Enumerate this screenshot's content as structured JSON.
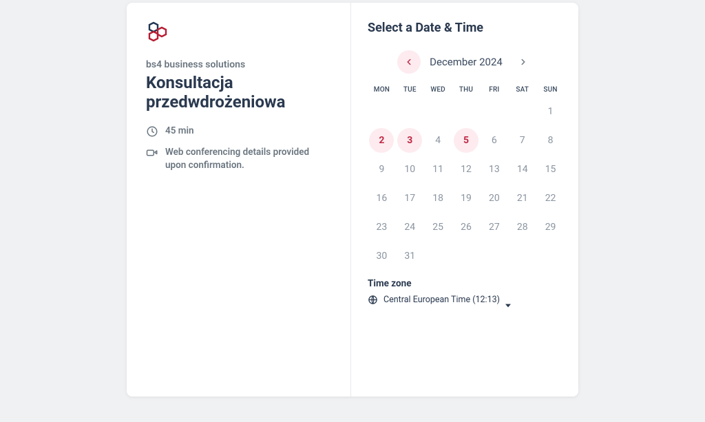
{
  "left": {
    "organizer": "bs4 business solutions",
    "title": "Konsultacja przedwdrożeniowa",
    "duration": "45 min",
    "conferencing": "Web conferencing details provided upon confirmation."
  },
  "right": {
    "heading": "Select a Date & Time",
    "month": "December 2024",
    "weekdays": [
      "MON",
      "TUE",
      "WED",
      "THU",
      "FRI",
      "SAT",
      "SUN"
    ],
    "days": [
      {
        "n": "",
        "state": "empty"
      },
      {
        "n": "",
        "state": "empty"
      },
      {
        "n": "",
        "state": "empty"
      },
      {
        "n": "",
        "state": "empty"
      },
      {
        "n": "",
        "state": "empty"
      },
      {
        "n": "",
        "state": "empty"
      },
      {
        "n": "1",
        "state": "disabled"
      },
      {
        "n": "2",
        "state": "available"
      },
      {
        "n": "3",
        "state": "available"
      },
      {
        "n": "4",
        "state": "disabled"
      },
      {
        "n": "5",
        "state": "available"
      },
      {
        "n": "6",
        "state": "disabled"
      },
      {
        "n": "7",
        "state": "disabled"
      },
      {
        "n": "8",
        "state": "disabled"
      },
      {
        "n": "9",
        "state": "disabled"
      },
      {
        "n": "10",
        "state": "disabled"
      },
      {
        "n": "11",
        "state": "disabled"
      },
      {
        "n": "12",
        "state": "disabled"
      },
      {
        "n": "13",
        "state": "disabled"
      },
      {
        "n": "14",
        "state": "disabled"
      },
      {
        "n": "15",
        "state": "disabled"
      },
      {
        "n": "16",
        "state": "disabled"
      },
      {
        "n": "17",
        "state": "disabled"
      },
      {
        "n": "18",
        "state": "disabled"
      },
      {
        "n": "19",
        "state": "disabled"
      },
      {
        "n": "20",
        "state": "disabled"
      },
      {
        "n": "21",
        "state": "disabled"
      },
      {
        "n": "22",
        "state": "disabled"
      },
      {
        "n": "23",
        "state": "disabled"
      },
      {
        "n": "24",
        "state": "disabled"
      },
      {
        "n": "25",
        "state": "disabled"
      },
      {
        "n": "26",
        "state": "disabled"
      },
      {
        "n": "27",
        "state": "disabled"
      },
      {
        "n": "28",
        "state": "disabled"
      },
      {
        "n": "29",
        "state": "disabled"
      },
      {
        "n": "30",
        "state": "disabled"
      },
      {
        "n": "31",
        "state": "disabled"
      }
    ],
    "timezone_label": "Time zone",
    "timezone_value": "Central European Time (12:13)"
  }
}
